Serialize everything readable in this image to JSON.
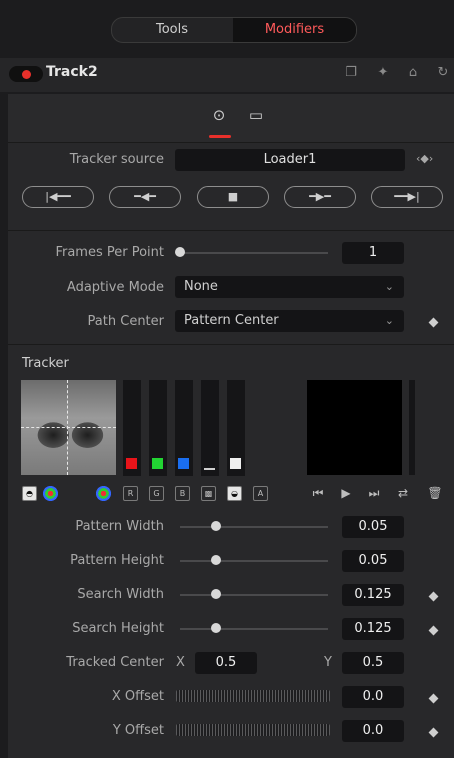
{
  "tabs": {
    "tools": "Tools",
    "modifiers": "Modifiers"
  },
  "tool": {
    "name": "Track2"
  },
  "tracker_source": {
    "label": "Tracker source",
    "value": "Loader1"
  },
  "frames_per_point": {
    "label": "Frames Per Point",
    "value": "1"
  },
  "adaptive_mode": {
    "label": "Adaptive Mode",
    "value": "None"
  },
  "path_center": {
    "label": "Path Center",
    "value": "Pattern Center"
  },
  "tracker_section": {
    "title": "Tracker"
  },
  "channel_buttons": [
    "R",
    "G",
    "B",
    "A"
  ],
  "channel_colors": {
    "red": "#e8141a",
    "green": "#22d433",
    "blue": "#1a6ef0",
    "white": "#efefef"
  },
  "pattern_width": {
    "label": "Pattern Width",
    "value": "0.05"
  },
  "pattern_height": {
    "label": "Pattern Height",
    "value": "0.05"
  },
  "search_width": {
    "label": "Search Width",
    "value": "0.125"
  },
  "search_height": {
    "label": "Search Height",
    "value": "0.125"
  },
  "tracked_center": {
    "label": "Tracked Center",
    "x_label": "X",
    "x_value": "0.5",
    "y_label": "Y",
    "y_value": "0.5"
  },
  "x_offset": {
    "label": "X Offset",
    "value": "0.0"
  },
  "y_offset": {
    "label": "Y Offset",
    "value": "0.0"
  },
  "accent_color": "#e8302b"
}
